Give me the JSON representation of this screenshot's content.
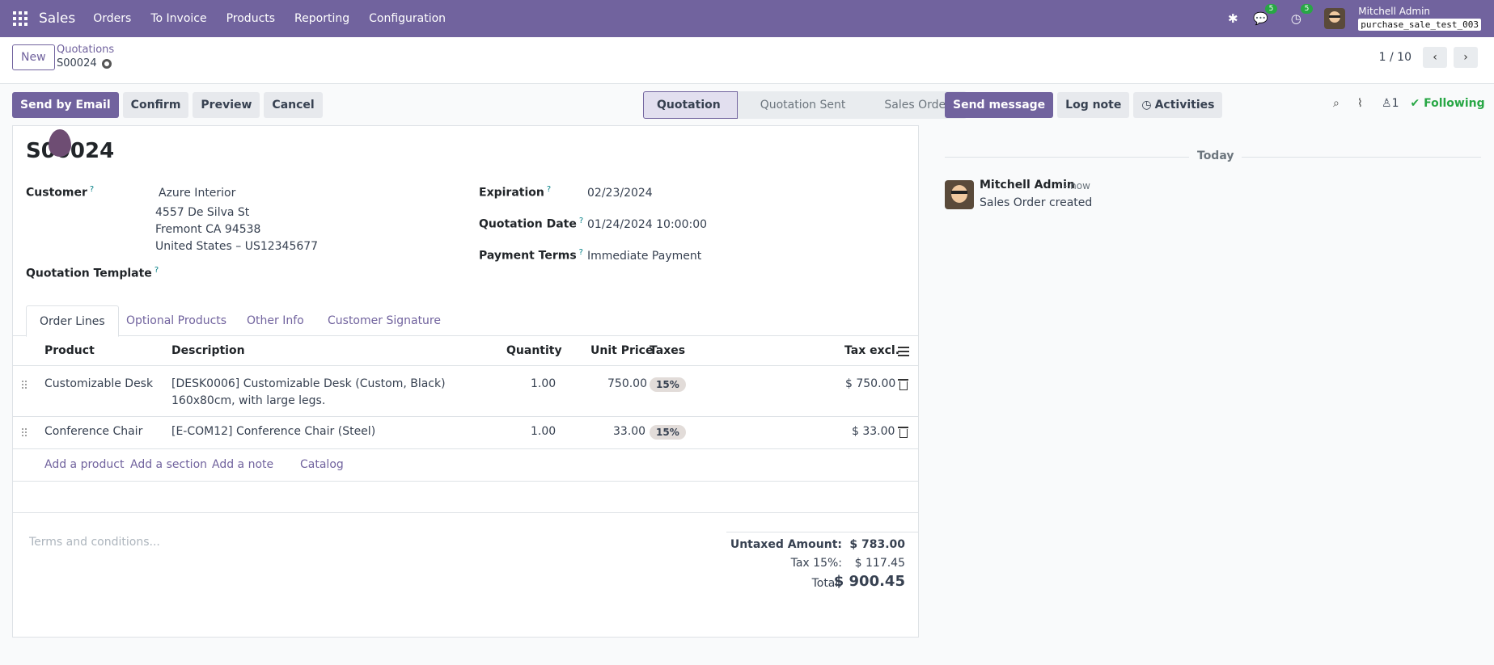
{
  "nav": {
    "app": "Sales",
    "menu": [
      "Orders",
      "To Invoice",
      "Products",
      "Reporting",
      "Configuration"
    ],
    "messages_count": "5",
    "activities_count": "5",
    "user_name": "Mitchell Admin",
    "database": "purchase_sale_test_003"
  },
  "control": {
    "new_label": "New",
    "breadcrumb_parent": "Quotations",
    "breadcrumb_current": "S00024",
    "pager": "1 / 10"
  },
  "actions": {
    "send_email": "Send by Email",
    "confirm": "Confirm",
    "preview": "Preview",
    "cancel": "Cancel"
  },
  "status": [
    "Quotation",
    "Quotation Sent",
    "Sales Order"
  ],
  "form": {
    "title": "S00024",
    "customer_label": "Customer",
    "customer_name": "Azure Interior",
    "address_1": "4557 De Silva St",
    "address_2": "Fremont CA 94538",
    "address_3": "United States – US12345677",
    "template_label": "Quotation Template",
    "expiration_label": "Expiration",
    "expiration_value": "02/23/2024",
    "qdate_label": "Quotation Date",
    "qdate_value": "01/24/2024 10:00:00",
    "terms_label": "Payment Terms",
    "terms_value": "Immediate Payment",
    "help": "?"
  },
  "tabs": [
    "Order Lines",
    "Optional Products",
    "Other Info",
    "Customer Signature"
  ],
  "table": {
    "headers": {
      "product": "Product",
      "description": "Description",
      "quantity": "Quantity",
      "unit_price": "Unit Price",
      "taxes": "Taxes",
      "tax_excl": "Tax excl."
    },
    "rows": [
      {
        "product": "Customizable Desk",
        "description_1": "[DESK0006] Customizable Desk (Custom, Black)",
        "description_2": "160x80cm, with large legs.",
        "quantity": "1.00",
        "unit_price": "750.00",
        "tax": "15%",
        "subtotal": "$ 750.00"
      },
      {
        "product": "Conference Chair",
        "description_1": "[E-COM12] Conference Chair (Steel)",
        "quantity": "1.00",
        "unit_price": "33.00",
        "tax": "15%",
        "subtotal": "$ 33.00"
      }
    ],
    "add_product": "Add a product",
    "add_section": "Add a section",
    "add_note": "Add a note",
    "catalog": "Catalog"
  },
  "footer": {
    "terms_placeholder": "Terms and conditions...",
    "untaxed_label": "Untaxed Amount:",
    "untaxed_value": "$ 783.00",
    "tax_label": "Tax 15%:",
    "tax_value": "$ 117.45",
    "total_label": "Total:",
    "total_value": "$ 900.45"
  },
  "chatter": {
    "send_message": "Send message",
    "log_note": "Log note",
    "activities": "Activities",
    "followers": "1",
    "following": "Following",
    "today": "Today",
    "author": "Mitchell Admin",
    "time": "- now",
    "body": "Sales Order created"
  },
  "colors": {
    "brand": "#71639e",
    "success": "#28a745",
    "help": "#017e84"
  }
}
